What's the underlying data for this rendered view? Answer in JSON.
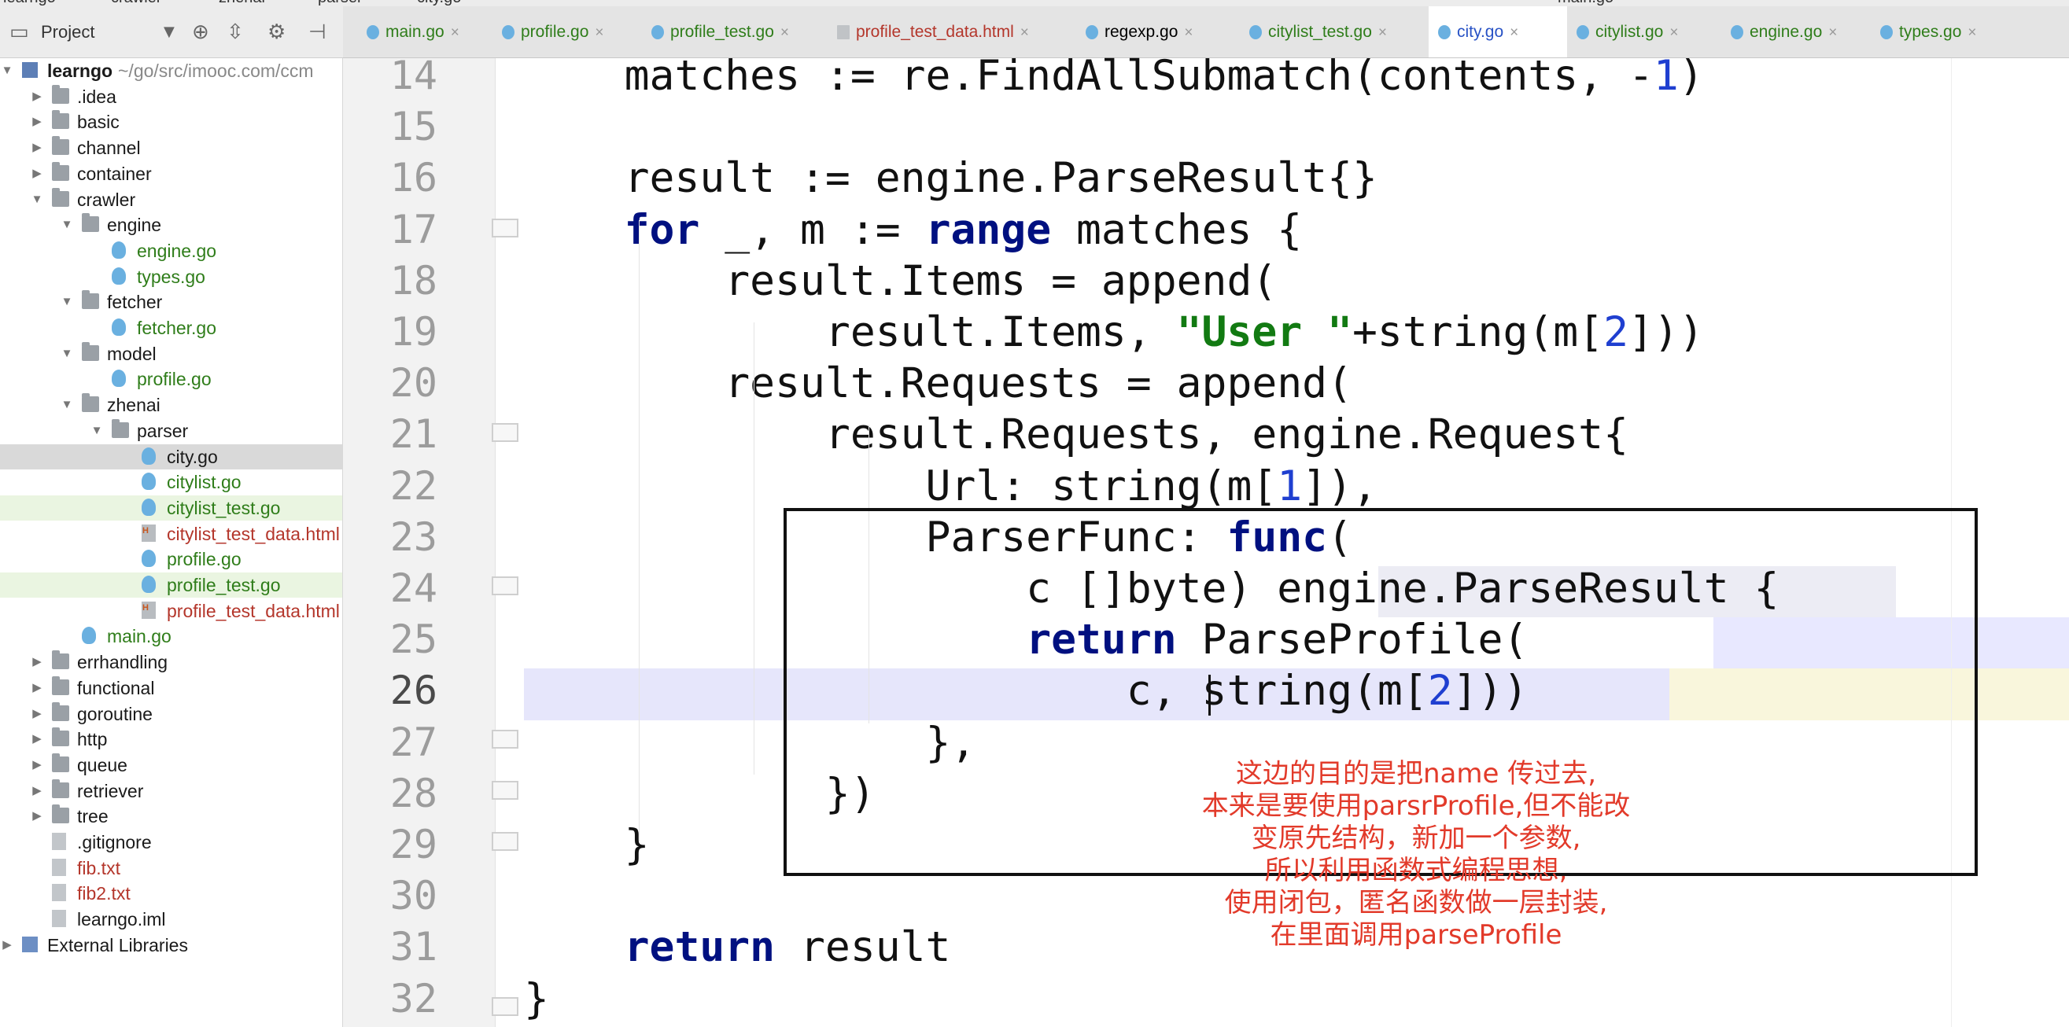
{
  "breadcrumb": [
    "learngo",
    "crawler",
    "zhenai",
    "parser",
    "city.go"
  ],
  "run_config": "main.go",
  "project_panel": {
    "title": "Project",
    "root_name": "learngo",
    "root_path": "~/go/src/imooc.com/ccm"
  },
  "tree": [
    {
      "label": "learngo",
      "kind": "module",
      "depth": 0,
      "expanded": true,
      "color": "dark"
    },
    {
      "label": ".idea",
      "kind": "folder",
      "depth": 1,
      "expanded": false,
      "color": "dark"
    },
    {
      "label": "basic",
      "kind": "folder",
      "depth": 1,
      "expanded": false,
      "color": "dark"
    },
    {
      "label": "channel",
      "kind": "folder",
      "depth": 1,
      "expanded": false,
      "color": "dark"
    },
    {
      "label": "container",
      "kind": "folder",
      "depth": 1,
      "expanded": false,
      "color": "dark"
    },
    {
      "label": "crawler",
      "kind": "folder",
      "depth": 1,
      "expanded": true,
      "color": "dark"
    },
    {
      "label": "engine",
      "kind": "folder",
      "depth": 2,
      "expanded": true,
      "color": "dark"
    },
    {
      "label": "engine.go",
      "kind": "go",
      "depth": 3,
      "color": "green"
    },
    {
      "label": "types.go",
      "kind": "go",
      "depth": 3,
      "color": "green"
    },
    {
      "label": "fetcher",
      "kind": "folder",
      "depth": 2,
      "expanded": true,
      "color": "dark"
    },
    {
      "label": "fetcher.go",
      "kind": "go",
      "depth": 3,
      "color": "green"
    },
    {
      "label": "model",
      "kind": "folder",
      "depth": 2,
      "expanded": true,
      "color": "dark"
    },
    {
      "label": "profile.go",
      "kind": "go",
      "depth": 3,
      "color": "green"
    },
    {
      "label": "zhenai",
      "kind": "folder",
      "depth": 2,
      "expanded": true,
      "color": "dark"
    },
    {
      "label": "parser",
      "kind": "folder",
      "depth": 3,
      "expanded": true,
      "color": "dark"
    },
    {
      "label": "city.go",
      "kind": "go",
      "depth": 4,
      "color": "dark",
      "selected": true
    },
    {
      "label": "citylist.go",
      "kind": "go",
      "depth": 4,
      "color": "green"
    },
    {
      "label": "citylist_test.go",
      "kind": "go",
      "depth": 4,
      "color": "green",
      "highlight": true
    },
    {
      "label": "citylist_test_data.html",
      "kind": "html",
      "depth": 4,
      "color": "red"
    },
    {
      "label": "profile.go",
      "kind": "go",
      "depth": 4,
      "color": "green"
    },
    {
      "label": "profile_test.go",
      "kind": "go",
      "depth": 4,
      "color": "green",
      "highlight": true
    },
    {
      "label": "profile_test_data.html",
      "kind": "html",
      "depth": 4,
      "color": "red"
    },
    {
      "label": "main.go",
      "kind": "go",
      "depth": 2,
      "color": "green"
    },
    {
      "label": "errhandling",
      "kind": "folder",
      "depth": 1,
      "expanded": false,
      "color": "dark"
    },
    {
      "label": "functional",
      "kind": "folder",
      "depth": 1,
      "expanded": false,
      "color": "dark"
    },
    {
      "label": "goroutine",
      "kind": "folder",
      "depth": 1,
      "expanded": false,
      "color": "dark"
    },
    {
      "label": "http",
      "kind": "folder",
      "depth": 1,
      "expanded": false,
      "color": "dark"
    },
    {
      "label": "queue",
      "kind": "folder",
      "depth": 1,
      "expanded": false,
      "color": "dark"
    },
    {
      "label": "retriever",
      "kind": "folder",
      "depth": 1,
      "expanded": false,
      "color": "dark"
    },
    {
      "label": "tree",
      "kind": "folder",
      "depth": 1,
      "expanded": false,
      "color": "dark"
    },
    {
      "label": ".gitignore",
      "kind": "txt",
      "depth": 1,
      "color": "dark"
    },
    {
      "label": "fib.txt",
      "kind": "txt",
      "depth": 1,
      "color": "red"
    },
    {
      "label": "fib2.txt",
      "kind": "txt",
      "depth": 1,
      "color": "red"
    },
    {
      "label": "learngo.iml",
      "kind": "txt",
      "depth": 1,
      "color": "dark"
    },
    {
      "label": "External Libraries",
      "kind": "libs",
      "depth": 0,
      "expanded": false,
      "color": "dark"
    }
  ],
  "tabs": [
    {
      "label": "main.go",
      "kind": "go",
      "color": "green"
    },
    {
      "label": "profile.go",
      "kind": "go",
      "color": "green"
    },
    {
      "label": "profile_test.go",
      "kind": "go",
      "color": "green"
    },
    {
      "label": "profile_test_data.html",
      "kind": "html",
      "color": "red"
    },
    {
      "label": "regexp.go",
      "kind": "go",
      "color": "dark"
    },
    {
      "label": "citylist_test.go",
      "kind": "go",
      "color": "green"
    },
    {
      "label": "city.go",
      "kind": "go",
      "color": "blue",
      "active": true
    },
    {
      "label": "citylist.go",
      "kind": "go",
      "color": "green"
    },
    {
      "label": "engine.go",
      "kind": "go",
      "color": "green"
    },
    {
      "label": "types.go",
      "kind": "go",
      "color": "green"
    }
  ],
  "editor": {
    "current_line": 26,
    "lines": [
      {
        "n": "14",
        "tokens": [
          [
            "t",
            "    matches := re.FindAllSubmatch(contents, -"
          ],
          [
            "num",
            "1"
          ],
          [
            "t",
            ")"
          ]
        ]
      },
      {
        "n": "15",
        "tokens": []
      },
      {
        "n": "16",
        "tokens": [
          [
            "t",
            "    result := engine.ParseResult{}"
          ]
        ]
      },
      {
        "n": "17",
        "tokens": [
          [
            "t",
            "    "
          ],
          [
            "kw",
            "for"
          ],
          [
            "t",
            " _, m := "
          ],
          [
            "kw",
            "range"
          ],
          [
            "t",
            " matches {"
          ]
        ]
      },
      {
        "n": "18",
        "tokens": [
          [
            "t",
            "        result.Items = append("
          ]
        ]
      },
      {
        "n": "19",
        "tokens": [
          [
            "t",
            "            result.Items, "
          ],
          [
            "str",
            "\"User \""
          ],
          [
            "t",
            "+string(m["
          ],
          [
            "num",
            "2"
          ],
          [
            "t",
            "]))"
          ]
        ]
      },
      {
        "n": "20",
        "tokens": [
          [
            "t",
            "        result.Requests = append("
          ]
        ]
      },
      {
        "n": "21",
        "tokens": [
          [
            "t",
            "            result.Requests, engine.Request{"
          ]
        ]
      },
      {
        "n": "22",
        "tokens": [
          [
            "t",
            "                Url: string(m["
          ],
          [
            "num",
            "1"
          ],
          [
            "t",
            "]),"
          ]
        ]
      },
      {
        "n": "23",
        "tokens": [
          [
            "t",
            "                ParserFunc: "
          ],
          [
            "kw",
            "func"
          ],
          [
            "t",
            "("
          ]
        ]
      },
      {
        "n": "24",
        "tokens": [
          [
            "t",
            "                    c []byte) engine.ParseResult {"
          ]
        ]
      },
      {
        "n": "25",
        "tokens": [
          [
            "t",
            "                    "
          ],
          [
            "kw",
            "return"
          ],
          [
            "t",
            " ParseProfile("
          ]
        ]
      },
      {
        "n": "26",
        "tokens": [
          [
            "t",
            "                        c, string(m["
          ],
          [
            "num",
            "2"
          ],
          [
            "t",
            "]))"
          ]
        ]
      },
      {
        "n": "27",
        "tokens": [
          [
            "t",
            "                },"
          ]
        ]
      },
      {
        "n": "28",
        "tokens": [
          [
            "t",
            "            })"
          ]
        ]
      },
      {
        "n": "29",
        "tokens": [
          [
            "t",
            "    }"
          ]
        ]
      },
      {
        "n": "30",
        "tokens": []
      },
      {
        "n": "31",
        "tokens": [
          [
            "t",
            "    "
          ],
          [
            "kw",
            "return"
          ],
          [
            "t",
            " result"
          ]
        ]
      },
      {
        "n": "32",
        "tokens": [
          [
            "t",
            "}"
          ]
        ]
      }
    ]
  },
  "annotation": {
    "color": "#e23a2a",
    "lines": [
      "这边的目的是把name 传过去,",
      "本来是要使用parsrProfile,但不能改",
      "变原先结构，新加一个参数,",
      "所以利用函数式编程思想,",
      "使用闭包，匿名函数做一层封装,",
      "在里面调用parseProfile"
    ]
  }
}
